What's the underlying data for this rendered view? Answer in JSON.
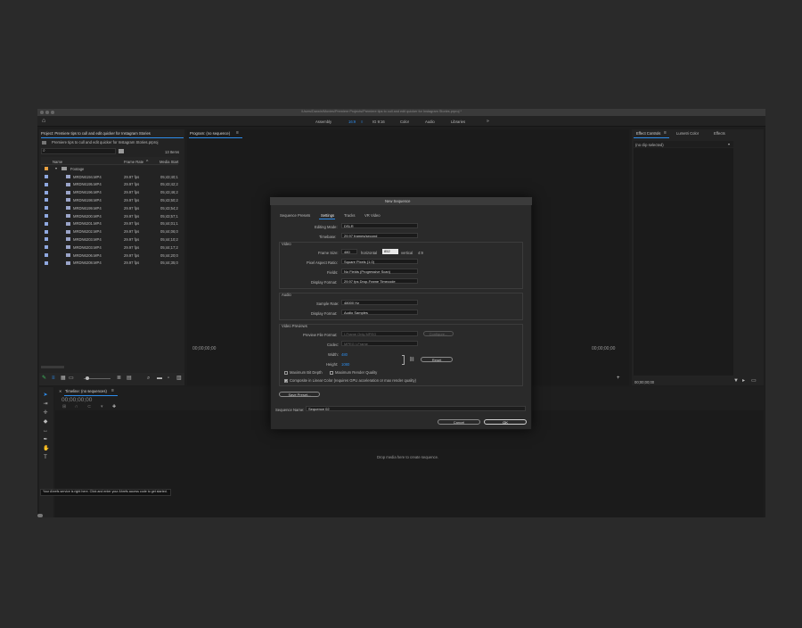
{
  "window": {
    "title": "/Users/Darwin/Movies/Premiere Projects/Premiere tips to cull and edit quicker for Instagram Stories.prproj *",
    "workspaces": [
      "Assembly",
      "16:9",
      "≡",
      "IG 9:16",
      "Color",
      "Audio",
      "Libraries",
      "»"
    ]
  },
  "project": {
    "title": "Project: Premiere tips to cull and edit quicker for Instagram Stories",
    "file": "Premiere tips to cull and edit quicker for Instagram Stories.prproj",
    "item_count": "13 Items",
    "columns": [
      "Name",
      "Frame Rate",
      "Media Start"
    ],
    "folder": "Footage",
    "rows": [
      {
        "name": "MRDN6194.MP4",
        "fps": "29.97 fps",
        "start": "05;43;40;1"
      },
      {
        "name": "MRDN6195.MP4",
        "fps": "29.97 fps",
        "start": "05;43;42;2"
      },
      {
        "name": "MRDN6196.MP4",
        "fps": "29.97 fps",
        "start": "05;43;46;2"
      },
      {
        "name": "MRDN6198.MP4",
        "fps": "29.97 fps",
        "start": "05;43;50;2"
      },
      {
        "name": "MRDN6199.MP4",
        "fps": "29.97 fps",
        "start": "05;43;54;2"
      },
      {
        "name": "MRDN6200.MP4",
        "fps": "29.97 fps",
        "start": "05;43;57;1"
      },
      {
        "name": "MRDN6201.MP4",
        "fps": "29.97 fps",
        "start": "05;44;01;1"
      },
      {
        "name": "MRDN6202.MP4",
        "fps": "29.97 fps",
        "start": "05;44;06;0"
      },
      {
        "name": "MRDN6203.MP4",
        "fps": "29.97 fps",
        "start": "05;44;10;2"
      },
      {
        "name": "MRDN6203.MP4",
        "fps": "29.97 fps",
        "start": "05;44;17;2"
      },
      {
        "name": "MRDN6206.MP4",
        "fps": "29.97 fps",
        "start": "05;44;20;0"
      },
      {
        "name": "MRDN6208.MP4",
        "fps": "29.97 fps",
        "start": "05;44;35;0"
      }
    ]
  },
  "program": {
    "title": "Program: (no sequence)",
    "tc_left": "00;00;00;00",
    "tc_right": "00;00;00;00"
  },
  "effects": {
    "tabs": [
      "Effect Controls",
      "Lumetri Color",
      "Effects"
    ],
    "clip": "(no clip selected)",
    "tc": "00;00;00;00"
  },
  "timeline": {
    "title": "Timeline: (no sequences)",
    "tc": "00;00;00;00",
    "drop_hint": "Drop media here to create sequence."
  },
  "tooltip": "Your Ahrefs service is right here. Click and enter your Ahrefs access code to get started.",
  "dialog": {
    "title": "New Sequence",
    "tabs": [
      "Sequence Presets",
      "Settings",
      "Tracks",
      "VR Video"
    ],
    "editing_mode_label": "Editing Mode:",
    "editing_mode": "DSLR",
    "timebase_label": "Timebase:",
    "timebase": "29.97  frames/second",
    "video_label": "Video",
    "frame_size_label": "Frame Size:",
    "frame_w": "480",
    "horizontal": "horizontal",
    "frame_h": "852",
    "vertical": "vertical",
    "aspect": "4:9",
    "par_label": "Pixel Aspect Ratio:",
    "par": "Square Pixels (1.0)",
    "fields_label": "Fields:",
    "fields": "No Fields (Progressive Scan)",
    "display_format_label": "Display Format:",
    "display_format": "29.97 fps Drop-Frame Timecode",
    "audio_label": "Audio",
    "sample_rate_label": "Sample Rate:",
    "sample_rate": "48000 Hz",
    "audio_display_label": "Display Format:",
    "audio_display": "Audio Samples",
    "previews_label": "Video Previews",
    "preview_format_label": "Preview File Format:",
    "preview_format": "I-Frame Only MPEG",
    "configure": "Configure...",
    "codec_label": "Codec:",
    "codec": "MPEG I-Frame",
    "width_label": "Width:",
    "width": "480",
    "height_label": "Height:",
    "height": "1080",
    "reset": "Reset",
    "max_bit_depth": "Maximum Bit Depth",
    "max_render": "Maximum Render Quality",
    "composite": "Composite in Linear Color (requires GPU acceleration or max render quality)",
    "save_preset": "Save Preset...",
    "seq_name_label": "Sequence Name:",
    "seq_name": "Sequence 02",
    "cancel": "Cancel",
    "ok": "OK"
  },
  "colors": {
    "accent": "#2d8ceb",
    "label_blue": "#8fa8e0",
    "folder": "#e8a040"
  }
}
